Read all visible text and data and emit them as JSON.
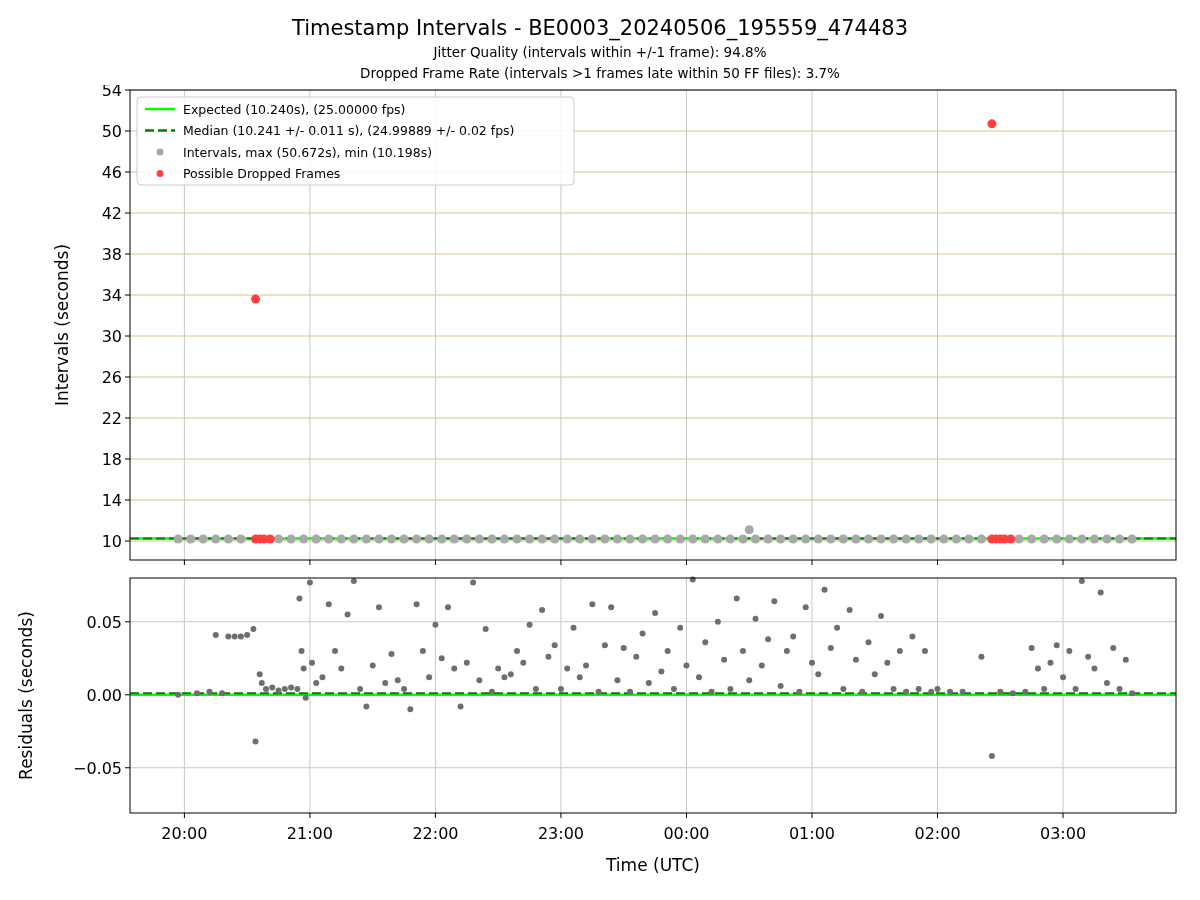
{
  "figure": {
    "title": "Timestamp Intervals - BE0003_20240506_195559_474483",
    "subtitles": [
      "Jitter Quality (intervals within +/-1 frame): 94.8%",
      "Dropped Frame Rate (intervals >1 frames late within 50 FF files): 3.7%"
    ]
  },
  "charts": [
    {
      "chart_data": {
        "type": "scatter",
        "ylabel": "Intervals (seconds)",
        "xlim": [
          "2024-05-06T19:34",
          "2024-05-07T03:54"
        ],
        "ylim": [
          8.15,
          54
        ],
        "yticks": [
          10,
          14,
          18,
          22,
          26,
          30,
          34,
          38,
          42,
          46,
          50,
          54
        ],
        "grid": true,
        "legend": true,
        "ref_lines": [
          {
            "axis": "y",
            "value": 10.24,
            "label": "Expected (10.240s), (25.00000 fps)",
            "color": "#00ff00"
          },
          {
            "axis": "y",
            "value": 10.24,
            "label": "Median (10.241 +/- 0.011 s), (24.99889 +/- 0.02 fps)",
            "color": "#008000"
          }
        ],
        "series": [
          {
            "name": "Intervals, max (50.672s), min (10.198s)",
            "color": "#a8a8a8",
            "x": [
              "2024-05-06T19:57",
              "2024-05-06T20:03",
              "2024-05-06T20:09",
              "2024-05-06T20:15",
              "2024-05-06T20:21",
              "2024-05-06T20:27",
              "2024-05-06T20:45",
              "2024-05-06T20:51",
              "2024-05-06T20:57",
              "2024-05-06T21:03",
              "2024-05-06T21:09",
              "2024-05-06T21:15",
              "2024-05-06T21:21",
              "2024-05-06T21:27",
              "2024-05-06T21:33",
              "2024-05-06T21:39",
              "2024-05-06T21:45",
              "2024-05-06T21:51",
              "2024-05-06T21:57",
              "2024-05-06T22:03",
              "2024-05-06T22:09",
              "2024-05-06T22:15",
              "2024-05-06T22:21",
              "2024-05-06T22:27",
              "2024-05-06T22:33",
              "2024-05-06T22:39",
              "2024-05-06T22:45",
              "2024-05-06T22:51",
              "2024-05-06T22:57",
              "2024-05-06T23:03",
              "2024-05-06T23:09",
              "2024-05-06T23:15",
              "2024-05-06T23:21",
              "2024-05-06T23:27",
              "2024-05-06T23:33",
              "2024-05-06T23:39",
              "2024-05-06T23:45",
              "2024-05-06T23:51",
              "2024-05-06T23:57",
              "2024-05-07T00:03",
              "2024-05-07T00:09",
              "2024-05-07T00:15",
              "2024-05-07T00:21",
              "2024-05-07T00:27",
              "2024-05-07T00:30",
              "2024-05-07T00:33",
              "2024-05-07T00:39",
              "2024-05-07T00:45",
              "2024-05-07T00:51",
              "2024-05-07T00:57",
              "2024-05-07T01:03",
              "2024-05-07T01:09",
              "2024-05-07T01:15",
              "2024-05-07T01:21",
              "2024-05-07T01:27",
              "2024-05-07T01:33",
              "2024-05-07T01:39",
              "2024-05-07T01:45",
              "2024-05-07T01:51",
              "2024-05-07T01:57",
              "2024-05-07T02:03",
              "2024-05-07T02:09",
              "2024-05-07T02:15",
              "2024-05-07T02:21",
              "2024-05-07T02:39",
              "2024-05-07T02:45",
              "2024-05-07T02:51",
              "2024-05-07T02:57",
              "2024-05-07T03:03",
              "2024-05-07T03:09",
              "2024-05-07T03:15",
              "2024-05-07T03:21",
              "2024-05-07T03:27",
              "2024-05-07T03:33"
            ],
            "values": [
              10.2,
              10.2,
              10.2,
              10.2,
              10.2,
              10.2,
              10.2,
              10.2,
              10.2,
              10.2,
              10.2,
              10.2,
              10.2,
              10.2,
              10.2,
              10.2,
              10.2,
              10.2,
              10.2,
              10.2,
              10.2,
              10.2,
              10.2,
              10.2,
              10.2,
              10.2,
              10.2,
              10.2,
              10.2,
              10.2,
              10.2,
              10.2,
              10.2,
              10.2,
              10.2,
              10.2,
              10.2,
              10.2,
              10.2,
              10.2,
              10.2,
              10.2,
              10.2,
              10.2,
              11.1,
              10.2,
              10.2,
              10.2,
              10.2,
              10.2,
              10.2,
              10.2,
              10.2,
              10.2,
              10.2,
              10.2,
              10.2,
              10.2,
              10.2,
              10.2,
              10.2,
              10.2,
              10.2,
              10.2,
              10.2,
              10.2,
              10.2,
              10.2,
              10.2,
              10.2,
              10.2,
              10.2,
              10.2,
              10.2
            ]
          },
          {
            "name": "Possible Dropped Frames",
            "color": "#ff4040",
            "x": [
              "2024-05-06T20:34",
              "2024-05-06T20:34",
              "2024-05-06T20:36",
              "2024-05-06T20:38",
              "2024-05-06T20:41",
              "2024-05-07T02:26",
              "2024-05-07T02:28",
              "2024-05-07T02:30",
              "2024-05-07T02:32",
              "2024-05-07T02:35",
              "2024-05-07T02:26"
            ],
            "values": [
              33.6,
              10.2,
              10.2,
              10.2,
              10.2,
              10.2,
              10.2,
              10.2,
              10.2,
              10.2,
              50.7
            ]
          }
        ]
      }
    },
    {
      "chart_data": {
        "type": "scatter",
        "xlabel": "Time (UTC)",
        "ylabel": "Residuals (seconds)",
        "xlim": [
          "2024-05-06T19:34",
          "2024-05-07T03:54"
        ],
        "ylim": [
          -0.081,
          0.08
        ],
        "grid": true,
        "xticks": [
          {
            "value": "2024-05-06T20:00",
            "label": "20:00"
          },
          {
            "value": "2024-05-06T21:00",
            "label": "21:00"
          },
          {
            "value": "2024-05-06T22:00",
            "label": "22:00"
          },
          {
            "value": "2024-05-06T23:00",
            "label": "23:00"
          },
          {
            "value": "2024-05-07T00:00",
            "label": "00:00"
          },
          {
            "value": "2024-05-07T01:00",
            "label": "01:00"
          },
          {
            "value": "2024-05-07T02:00",
            "label": "02:00"
          },
          {
            "value": "2024-05-07T03:00",
            "label": "03:00"
          }
        ],
        "yticks": [
          {
            "value": -0.05,
            "label": "−0.05"
          },
          {
            "value": 0,
            "label": "0.00"
          },
          {
            "value": 0.05,
            "label": "0.05"
          }
        ],
        "ref_lines": [
          {
            "axis": "y",
            "value": 0,
            "color": "#00ff00"
          },
          {
            "axis": "y",
            "value": 0.001,
            "color": "#008000"
          }
        ],
        "series": [
          {
            "color": "#6e6e6e",
            "x": [
              "2024-05-06T19:57",
              "2024-05-06T20:06",
              "2024-05-06T20:12",
              "2024-05-06T20:15",
              "2024-05-06T20:18",
              "2024-05-06T20:21",
              "2024-05-06T20:24",
              "2024-05-06T20:27",
              "2024-05-06T20:30",
              "2024-05-06T20:33",
              "2024-05-06T20:34",
              "2024-05-06T20:36",
              "2024-05-06T20:37",
              "2024-05-06T20:39",
              "2024-05-06T20:42",
              "2024-05-06T20:45",
              "2024-05-06T20:48",
              "2024-05-06T20:51",
              "2024-05-06T20:54",
              "2024-05-06T20:55",
              "2024-05-06T20:56",
              "2024-05-06T20:57",
              "2024-05-06T20:58",
              "2024-05-06T21:00",
              "2024-05-06T21:01",
              "2024-05-06T21:03",
              "2024-05-06T21:06",
              "2024-05-06T21:09",
              "2024-05-06T21:12",
              "2024-05-06T21:15",
              "2024-05-06T21:18",
              "2024-05-06T21:21",
              "2024-05-06T21:24",
              "2024-05-06T21:27",
              "2024-05-06T21:30",
              "2024-05-06T21:33",
              "2024-05-06T21:36",
              "2024-05-06T21:39",
              "2024-05-06T21:42",
              "2024-05-06T21:45",
              "2024-05-06T21:48",
              "2024-05-06T21:51",
              "2024-05-06T21:54",
              "2024-05-06T21:57",
              "2024-05-06T22:00",
              "2024-05-06T22:03",
              "2024-05-06T22:06",
              "2024-05-06T22:09",
              "2024-05-06T22:12",
              "2024-05-06T22:15",
              "2024-05-06T22:18",
              "2024-05-06T22:21",
              "2024-05-06T22:24",
              "2024-05-06T22:27",
              "2024-05-06T22:30",
              "2024-05-06T22:33",
              "2024-05-06T22:36",
              "2024-05-06T22:39",
              "2024-05-06T22:42",
              "2024-05-06T22:45",
              "2024-05-06T22:48",
              "2024-05-06T22:51",
              "2024-05-06T22:54",
              "2024-05-06T22:57",
              "2024-05-06T23:00",
              "2024-05-06T23:03",
              "2024-05-06T23:06",
              "2024-05-06T23:09",
              "2024-05-06T23:12",
              "2024-05-06T23:15",
              "2024-05-06T23:18",
              "2024-05-06T23:21",
              "2024-05-06T23:24",
              "2024-05-06T23:27",
              "2024-05-06T23:30",
              "2024-05-06T23:33",
              "2024-05-06T23:36",
              "2024-05-06T23:39",
              "2024-05-06T23:42",
              "2024-05-06T23:45",
              "2024-05-06T23:48",
              "2024-05-06T23:51",
              "2024-05-06T23:54",
              "2024-05-06T23:57",
              "2024-05-07T00:00",
              "2024-05-07T00:03",
              "2024-05-07T00:06",
              "2024-05-07T00:09",
              "2024-05-07T00:12",
              "2024-05-07T00:15",
              "2024-05-07T00:18",
              "2024-05-07T00:21",
              "2024-05-07T00:24",
              "2024-05-07T00:27",
              "2024-05-07T00:30",
              "2024-05-07T00:33",
              "2024-05-07T00:36",
              "2024-05-07T00:39",
              "2024-05-07T00:42",
              "2024-05-07T00:45",
              "2024-05-07T00:48",
              "2024-05-07T00:51",
              "2024-05-07T00:54",
              "2024-05-07T00:57",
              "2024-05-07T01:00",
              "2024-05-07T01:03",
              "2024-05-07T01:06",
              "2024-05-07T01:09",
              "2024-05-07T01:12",
              "2024-05-07T01:15",
              "2024-05-07T01:18",
              "2024-05-07T01:21",
              "2024-05-07T01:24",
              "2024-05-07T01:27",
              "2024-05-07T01:30",
              "2024-05-07T01:33",
              "2024-05-07T01:36",
              "2024-05-07T01:39",
              "2024-05-07T01:42",
              "2024-05-07T01:45",
              "2024-05-07T01:48",
              "2024-05-07T01:51",
              "2024-05-07T01:54",
              "2024-05-07T01:57",
              "2024-05-07T02:00",
              "2024-05-07T02:06",
              "2024-05-07T02:12",
              "2024-05-07T02:21",
              "2024-05-07T02:26",
              "2024-05-07T02:30",
              "2024-05-07T02:36",
              "2024-05-07T02:42",
              "2024-05-07T02:45",
              "2024-05-07T02:48",
              "2024-05-07T02:51",
              "2024-05-07T02:54",
              "2024-05-07T02:57",
              "2024-05-07T03:00",
              "2024-05-07T03:03",
              "2024-05-07T03:06",
              "2024-05-07T03:09",
              "2024-05-07T03:12",
              "2024-05-07T03:15",
              "2024-05-07T03:18",
              "2024-05-07T03:21",
              "2024-05-07T03:24",
              "2024-05-07T03:27",
              "2024-05-07T03:30",
              "2024-05-07T03:33"
            ],
            "values": [
              0,
              0.001,
              0.002,
              0.041,
              0.001,
              0.04,
              0.04,
              0.04,
              0.041,
              0.045,
              -0.032,
              0.014,
              0.008,
              0.004,
              0.005,
              0.003,
              0.004,
              0.005,
              0.004,
              0.066,
              0.03,
              0.018,
              -0.002,
              0.077,
              0.022,
              0.008,
              0.012,
              0.062,
              0.03,
              0.018,
              0.055,
              0.078,
              0.004,
              -0.008,
              0.02,
              0.06,
              0.008,
              0.028,
              0.01,
              0.004,
              -0.01,
              0.062,
              0.03,
              0.012,
              0.048,
              0.025,
              0.06,
              0.018,
              -0.008,
              0.022,
              0.077,
              0.01,
              0.045,
              0.002,
              0.018,
              0.012,
              0.014,
              0.03,
              0.022,
              0.048,
              0.004,
              0.058,
              0.026,
              0.034,
              0.004,
              0.018,
              0.046,
              0.012,
              0.02,
              0.062,
              0.002,
              0.034,
              0.06,
              0.01,
              0.032,
              0.002,
              0.026,
              0.042,
              0.008,
              0.056,
              0.016,
              0.03,
              0.004,
              0.046,
              0.02,
              0.079,
              0.012,
              0.036,
              0.002,
              0.05,
              0.024,
              0.004,
              0.066,
              0.03,
              0.01,
              0.052,
              0.02,
              0.038,
              0.064,
              0.006,
              0.03,
              0.04,
              0.002,
              0.06,
              0.022,
              0.014,
              0.072,
              0.032,
              0.046,
              0.004,
              0.058,
              0.024,
              0.002,
              0.036,
              0.014,
              0.054,
              0.022,
              0.004,
              0.03,
              0.002,
              0.04,
              0.004,
              0.03,
              0.002,
              0.004,
              0.002,
              0.002,
              0.026,
              -0.042,
              0.002,
              0.001,
              0.002,
              0.032,
              0.018,
              0.004,
              0.022,
              0.034,
              0.012,
              0.03,
              0.004,
              0.078,
              0.026,
              0.018,
              0.07,
              0.008,
              0.032,
              0.004,
              0.024,
              0.001
            ]
          }
        ]
      }
    }
  ]
}
